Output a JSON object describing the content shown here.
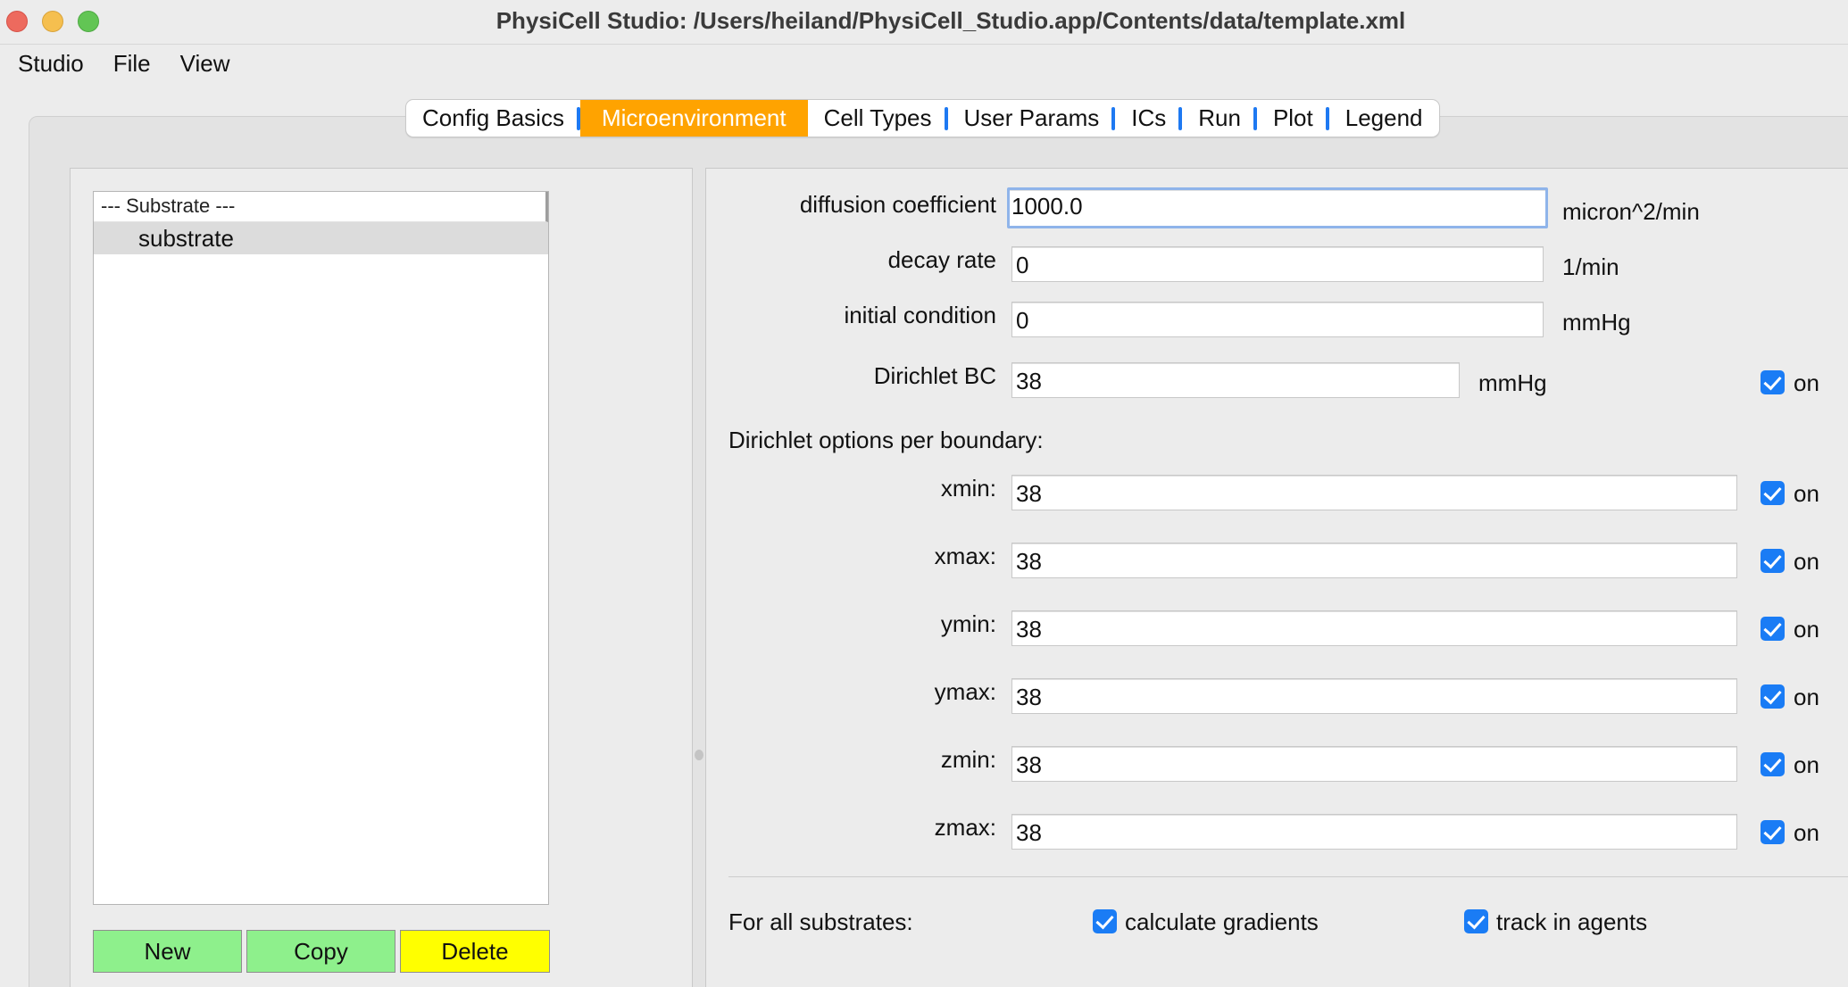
{
  "window": {
    "title": "PhysiCell Studio: /Users/heiland/PhysiCell_Studio.app/Contents/data/template.xml"
  },
  "menubar": {
    "items": [
      "Studio",
      "File",
      "View"
    ]
  },
  "tabs": {
    "items": [
      "Config Basics",
      "Microenvironment",
      "Cell Types",
      "User Params",
      "ICs",
      "Run",
      "Plot",
      "Legend"
    ],
    "active": "Microenvironment",
    "active_color": "#ffa300"
  },
  "substrates": {
    "header": "---  Substrate ---",
    "items": [
      "substrate"
    ],
    "buttons": {
      "new": "New",
      "copy": "Copy",
      "delete": "Delete"
    }
  },
  "params": {
    "diffusion": {
      "label": "diffusion coefficient",
      "value": "1000.0",
      "unit": "micron^2/min"
    },
    "decay": {
      "label": "decay rate",
      "value": "0",
      "unit": "1/min"
    },
    "initial": {
      "label": "initial condition",
      "value": "0",
      "unit": "mmHg"
    },
    "dirichlet": {
      "label": "Dirichlet BC",
      "value": "38",
      "unit": "mmHg",
      "checkbox_label": "on",
      "checked": true
    }
  },
  "boundaries": {
    "heading": "Dirichlet options per boundary:",
    "items": [
      {
        "label": "xmin:",
        "value": "38",
        "checkbox_label": "on",
        "checked": true
      },
      {
        "label": "xmax:",
        "value": "38",
        "checkbox_label": "on",
        "checked": true
      },
      {
        "label": "ymin:",
        "value": "38",
        "checkbox_label": "on",
        "checked": true
      },
      {
        "label": "ymax:",
        "value": "38",
        "checkbox_label": "on",
        "checked": true
      },
      {
        "label": "zmin:",
        "value": "38",
        "checkbox_label": "on",
        "checked": true
      },
      {
        "label": "zmax:",
        "value": "38",
        "checkbox_label": "on",
        "checked": true
      }
    ]
  },
  "all_substrates": {
    "label": "For all substrates:",
    "calculate_gradients": {
      "label": "calculate gradients",
      "checked": true
    },
    "track_in_agents": {
      "label": "track in agents",
      "checked": true
    }
  },
  "colors": {
    "checkbox": "#1a7cf5",
    "tab_separator": "#1e79f2",
    "new_copy_button": "#8ef08c",
    "delete_button": "#ffff00"
  }
}
